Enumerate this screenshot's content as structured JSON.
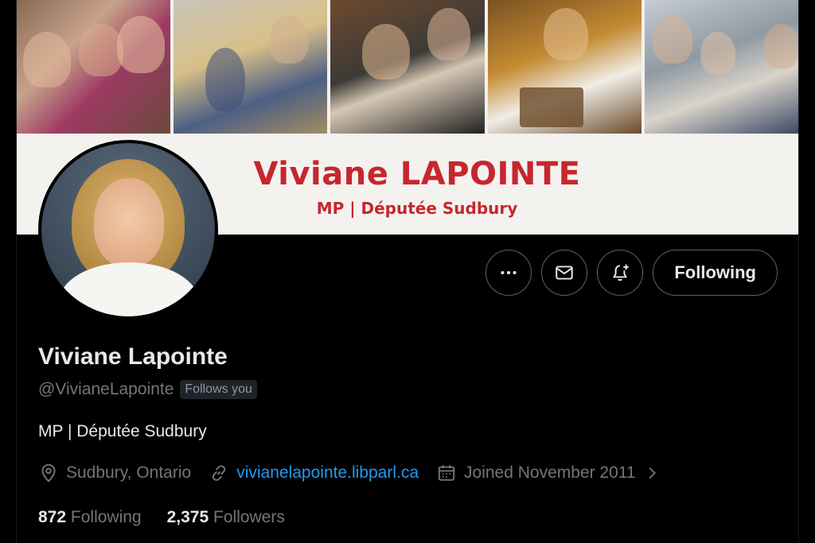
{
  "banner": {
    "name": "Viviane LAPOINTE",
    "subtitle": "MP | Députée Sudbury",
    "accent_color": "#c7262e"
  },
  "actions": {
    "more_icon": "more-horizontal-icon",
    "message_icon": "envelope-icon",
    "notify_icon": "bell-plus-icon",
    "follow_label": "Following"
  },
  "profile": {
    "display_name": "Viviane Lapointe",
    "handle": "@VivianeLapointe",
    "follows_you": "Follows you",
    "bio": "MP | Députée Sudbury",
    "location": "Sudbury, Ontario",
    "website": "vivianelapointe.libparl.ca",
    "joined": "Joined November 2011"
  },
  "stats": {
    "following_count": "872",
    "following_label": "Following",
    "followers_count": "2,375",
    "followers_label": "Followers"
  },
  "colors": {
    "link": "#1d9bf0",
    "muted": "#71767b",
    "background": "#000000"
  }
}
